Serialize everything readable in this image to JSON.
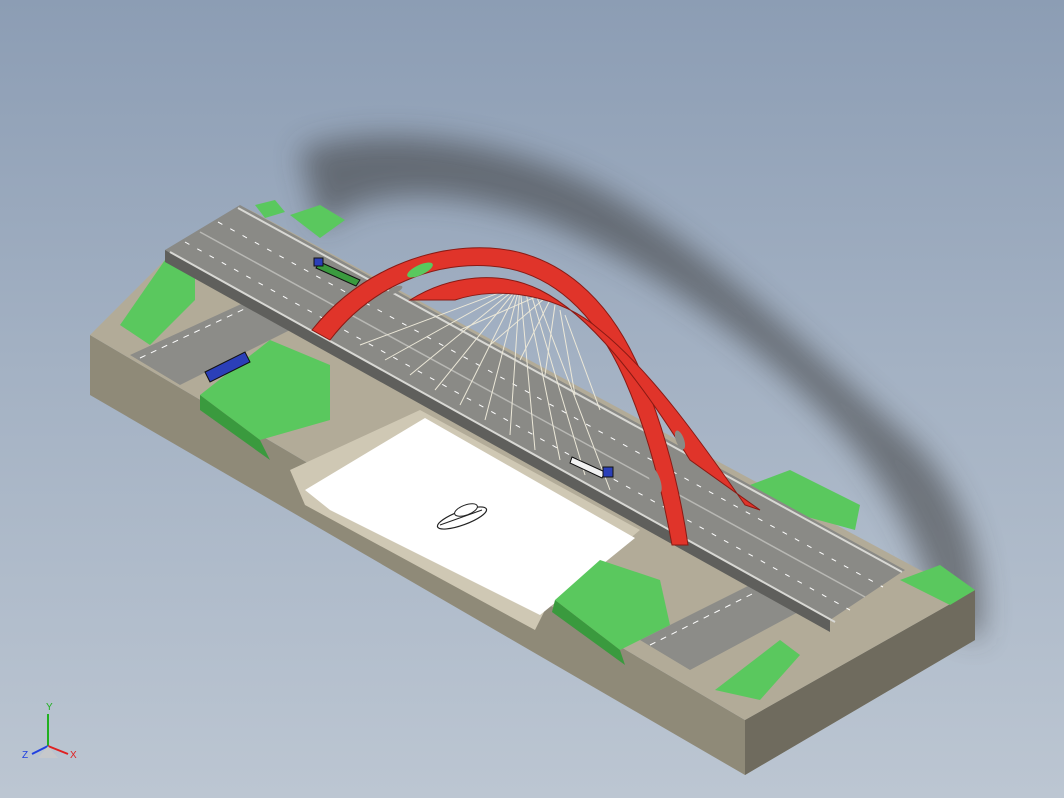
{
  "viewport": {
    "background_top": "#8c9db4",
    "background_bottom": "#bcc6d2"
  },
  "model": {
    "arch_color": "#e0342a",
    "grass_color": "#5ac85e",
    "terrain_color": "#a39c88",
    "deck_color": "#8a8a86",
    "water_color": "#ffffff",
    "truck_color": "#2b3fb8"
  },
  "triad": {
    "x_label": "X",
    "y_label": "Y",
    "z_label": "Z",
    "x_color": "#e02020",
    "y_color": "#20b020",
    "z_color": "#2040e0"
  }
}
